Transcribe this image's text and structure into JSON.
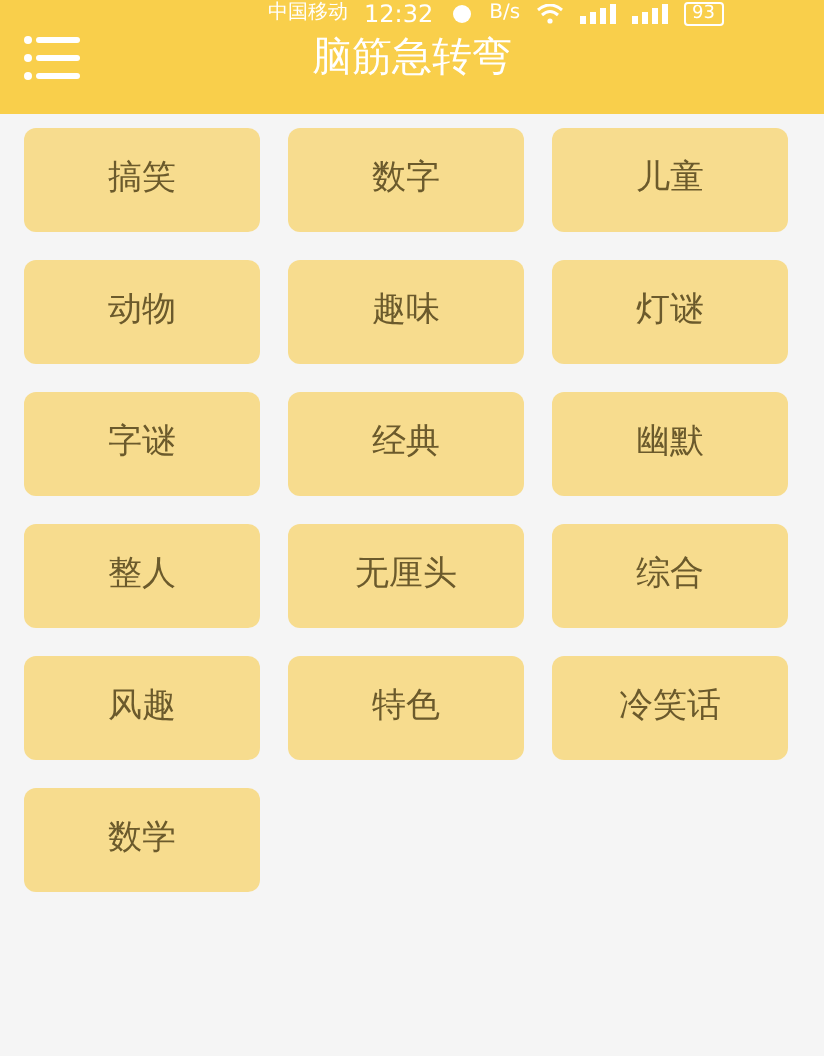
{
  "status_bar": {
    "carrier": "中国移动",
    "time": "12:32",
    "speed_unit": "B/s",
    "battery": "93"
  },
  "header": {
    "title": "脑筋急转弯"
  },
  "categories": [
    {
      "label": "搞笑"
    },
    {
      "label": "数字"
    },
    {
      "label": "儿童"
    },
    {
      "label": "动物"
    },
    {
      "label": "趣味"
    },
    {
      "label": "灯谜"
    },
    {
      "label": "字谜"
    },
    {
      "label": "经典"
    },
    {
      "label": "幽默"
    },
    {
      "label": "整人"
    },
    {
      "label": "无厘头"
    },
    {
      "label": "综合"
    },
    {
      "label": "风趣"
    },
    {
      "label": "特色"
    },
    {
      "label": "冷笑话"
    },
    {
      "label": "数学"
    }
  ]
}
